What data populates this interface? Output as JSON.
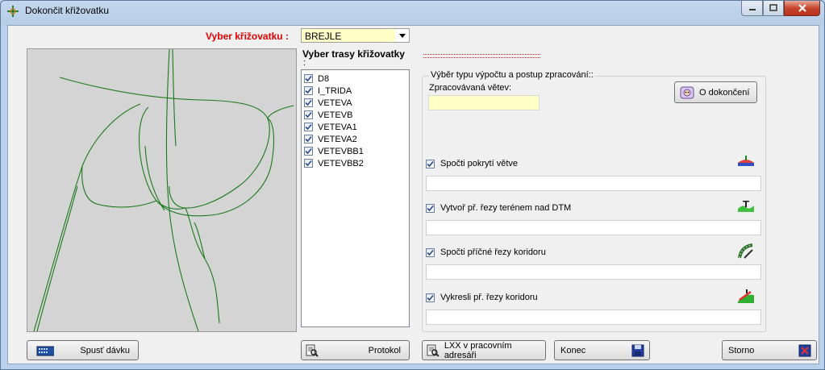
{
  "window": {
    "title": "Dokončit křižovatku"
  },
  "junction": {
    "label": "Vyber křižovatku :",
    "selected": "BREJLE"
  },
  "routes": {
    "label": "Vyber trasy křižovatky",
    "label_colon": ":",
    "items": [
      {
        "label": "D8",
        "checked": true
      },
      {
        "label": "I_TRIDA",
        "checked": true
      },
      {
        "label": "VETEVA",
        "checked": true
      },
      {
        "label": "VETEVB",
        "checked": true
      },
      {
        "label": "VETEVA1",
        "checked": true
      },
      {
        "label": "VETEVA2",
        "checked": true
      },
      {
        "label": "VETEVBB1",
        "checked": true
      },
      {
        "label": "VETEVBB2",
        "checked": true
      }
    ]
  },
  "processing": {
    "group_title": "Výběr typu výpočtu a postup zpracování::",
    "branch_label": "Zpracovávaná větev:",
    "branch_value": "",
    "about_button": "O dokončení",
    "options": [
      {
        "label": "Spočti pokrytí větve",
        "checked": true,
        "icon": "surface-cover-icon",
        "value": ""
      },
      {
        "label": "Vytvoř př. řezy terénem nad DTM",
        "checked": true,
        "icon": "terrain-section-icon",
        "value": ""
      },
      {
        "label": "Spočti příčné řezy koridoru",
        "checked": true,
        "icon": "corridor-section-icon",
        "value": ""
      },
      {
        "label": "Vykresli př. řezy koridoru",
        "checked": true,
        "icon": "draw-section-icon",
        "value": ""
      }
    ]
  },
  "buttons": {
    "spust": "Spusť dávku",
    "protokol": "Protokol",
    "lxx": "LXX v pracovním adresáři",
    "konec": "Konec",
    "storno": "Storno"
  },
  "colors": {
    "accent_red": "#e00000",
    "input_yellow": "#ffffc8",
    "road_green": "#1a7a1a",
    "map_bg": "#d4d4d4"
  }
}
